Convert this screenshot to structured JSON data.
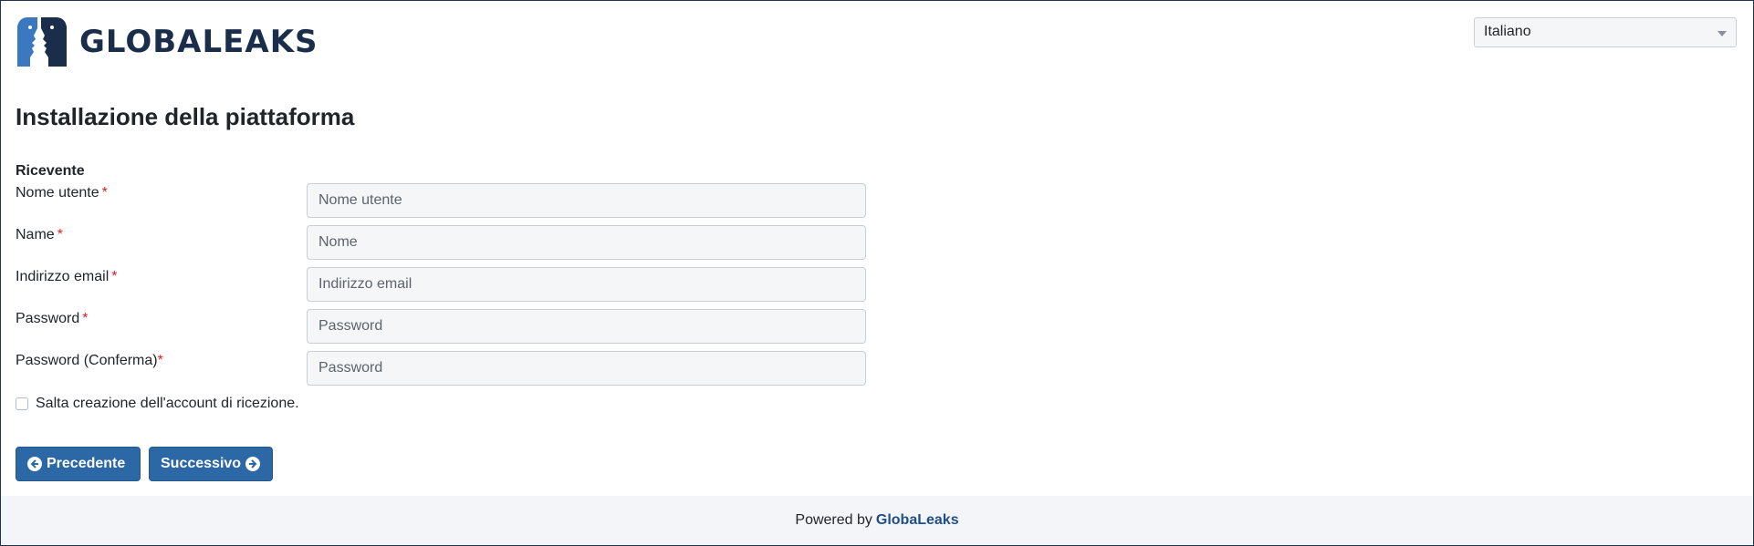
{
  "brand": {
    "name": "GLOBALEAKS",
    "colors": {
      "dark": "#1a2e4b",
      "light": "#3a78c0"
    }
  },
  "language_select": {
    "value": "Italiano",
    "icon": "chevron-down-icon"
  },
  "page": {
    "title": "Installazione della piattaforma",
    "section_title": "Ricevente"
  },
  "form": {
    "fields": [
      {
        "label": "Nome utente",
        "placeholder": "Nome utente",
        "value": "",
        "required": "*"
      },
      {
        "label": "Name",
        "placeholder": "Nome",
        "value": "",
        "required": "*"
      },
      {
        "label": "Indirizzo email",
        "placeholder": "Indirizzo email",
        "value": "",
        "required": "*"
      },
      {
        "label": "Password",
        "placeholder": "Password",
        "value": "",
        "required": "*"
      },
      {
        "label": "Password (Conferma)",
        "placeholder": "Password",
        "value": "",
        "required": "*"
      }
    ],
    "skip_checkbox_label": "Salta creazione dell'account di ricezione.",
    "required_color": "#d9222a"
  },
  "buttons": {
    "previous": "Precedente",
    "next": "Successivo",
    "color": "#2c68a6"
  },
  "footer": {
    "prefix": "Powered by",
    "link": "GlobaLeaks"
  }
}
